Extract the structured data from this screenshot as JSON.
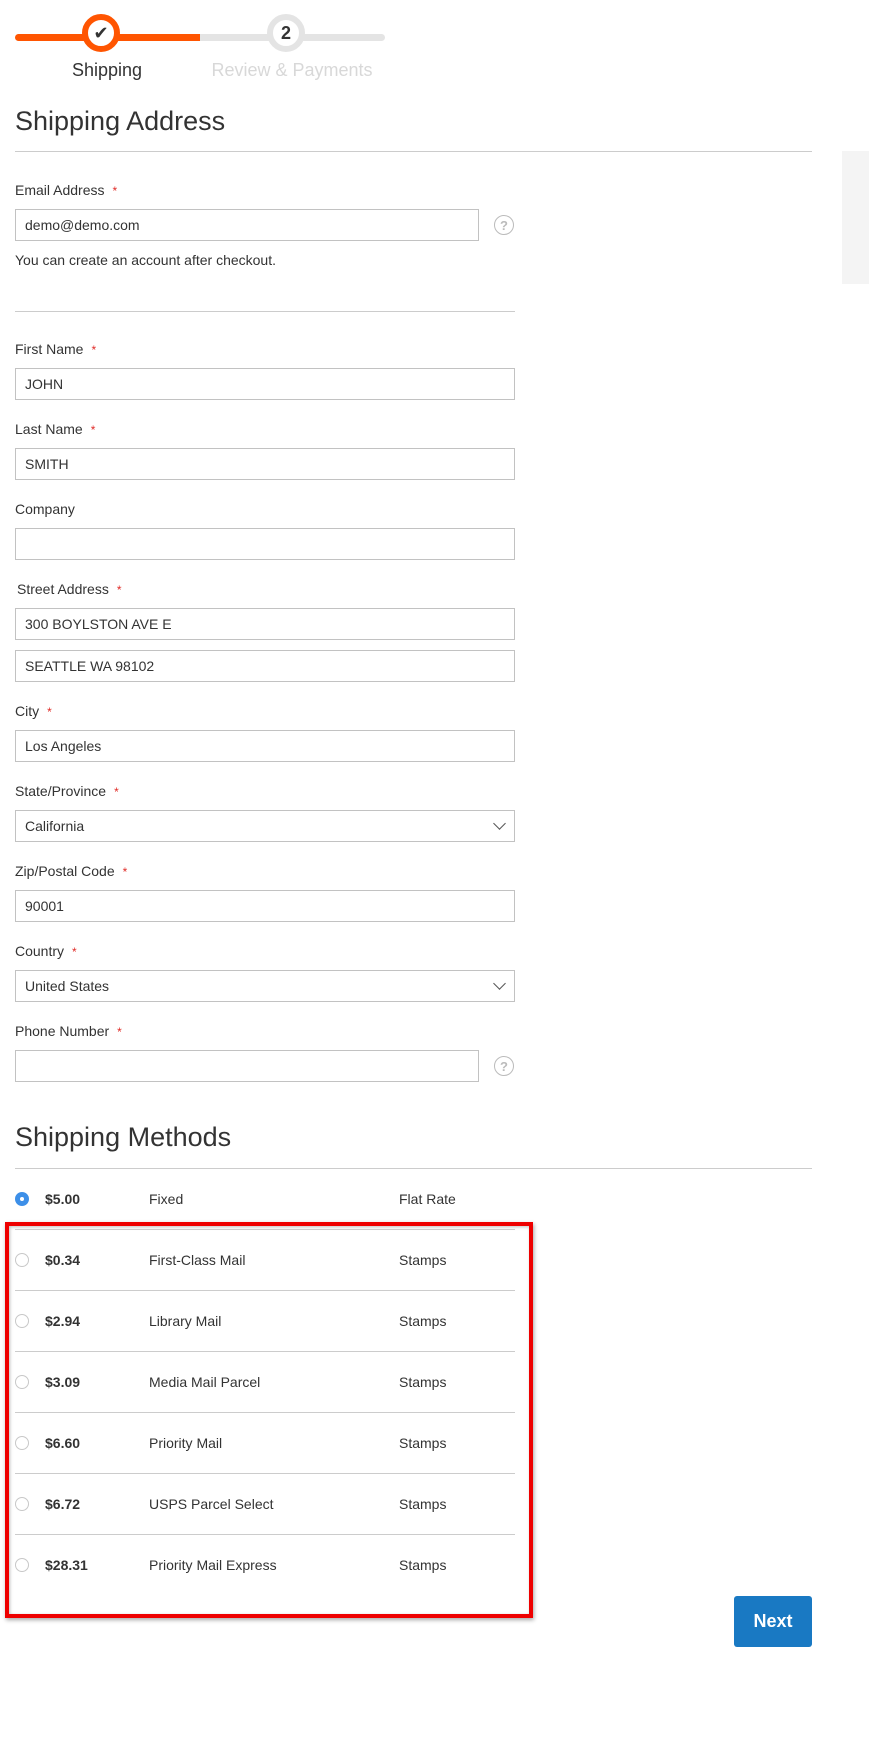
{
  "progress": {
    "steps": [
      {
        "label": "Shipping",
        "state": "complete",
        "marker": "✔"
      },
      {
        "label": "Review & Payments",
        "state": "pending",
        "marker": "2"
      }
    ],
    "active_color": "#ff5501",
    "inactive_color": "#e4e4e4"
  },
  "shipping_address": {
    "title": "Shipping Address",
    "email": {
      "label": "Email Address",
      "required": "*",
      "value": "demo@demo.com",
      "note": "You can create an account after checkout."
    },
    "first_name": {
      "label": "First Name",
      "required": "*",
      "value": "JOHN"
    },
    "last_name": {
      "label": "Last Name",
      "required": "*",
      "value": "SMITH"
    },
    "company": {
      "label": "Company",
      "value": ""
    },
    "street": {
      "label": "Street Address",
      "required": "*",
      "line1": "300 BOYLSTON AVE E",
      "line2": "SEATTLE WA 98102"
    },
    "city": {
      "label": "City",
      "required": "*",
      "value": "Los Angeles"
    },
    "state": {
      "label": "State/Province",
      "required": "*",
      "value": "California"
    },
    "zip": {
      "label": "Zip/Postal Code",
      "required": "*",
      "value": "90001"
    },
    "country": {
      "label": "Country",
      "required": "*",
      "value": "United States"
    },
    "phone": {
      "label": "Phone Number",
      "required": "*",
      "value": ""
    },
    "help_icon": "?"
  },
  "shipping_methods": {
    "title": "Shipping Methods",
    "rows": [
      {
        "price": "$5.00",
        "method": "Fixed",
        "carrier": "Flat Rate",
        "selected": true
      },
      {
        "price": "$0.34",
        "method": "First-Class Mail",
        "carrier": "Stamps",
        "selected": false
      },
      {
        "price": "$2.94",
        "method": "Library Mail",
        "carrier": "Stamps",
        "selected": false
      },
      {
        "price": "$3.09",
        "method": "Media Mail Parcel",
        "carrier": "Stamps",
        "selected": false
      },
      {
        "price": "$6.60",
        "method": "Priority Mail",
        "carrier": "Stamps",
        "selected": false
      },
      {
        "price": "$6.72",
        "method": "USPS Parcel Select",
        "carrier": "Stamps",
        "selected": false
      },
      {
        "price": "$28.31",
        "method": "Priority Mail Express",
        "carrier": "Stamps",
        "selected": false
      }
    ],
    "highlight_color": "#ee0000"
  },
  "actions": {
    "next_label": "Next",
    "next_color": "#1979c3"
  }
}
